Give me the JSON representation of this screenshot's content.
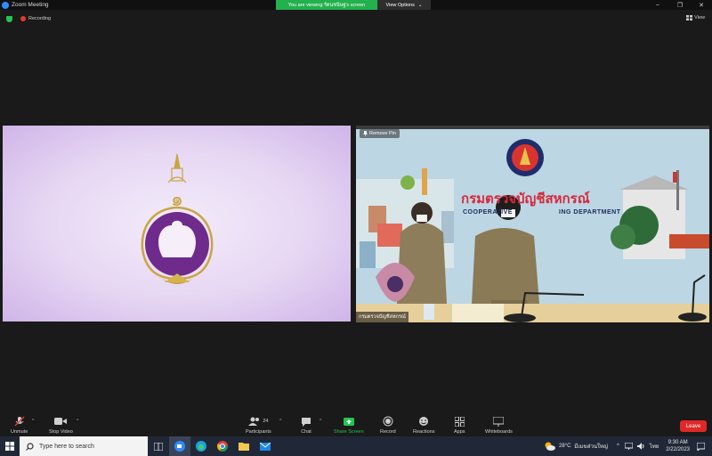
{
  "window": {
    "title": "Zoom Meeting",
    "minimize": "–",
    "restore": "❐",
    "close": "✕"
  },
  "share_banner": {
    "text": "You are viewing รัตนชนิษฐ's screen"
  },
  "view_options": {
    "label": "View Options",
    "caret": "⌄"
  },
  "recording": {
    "label": "Recording"
  },
  "view": {
    "label": "View"
  },
  "right_tile": {
    "remove_pin": "Remove Pin",
    "wall_title": "กรมตรวจบัญชีสหกรณ์",
    "wall_sub_1": "COOPERATIVE",
    "wall_sub_2": "ING  DEPARTMENT",
    "name_badge": "กรมตรวจบัญชีสหกรณ์"
  },
  "toolbar": {
    "unmute": "Unmute",
    "stop_video": "Stop Video",
    "participants": "Participants",
    "participants_count": "24",
    "chat": "Chat",
    "share_screen": "Share Screen",
    "record": "Record",
    "reactions": "Reactions",
    "apps": "Apps",
    "whiteboards": "Whiteboards",
    "leave": "Leave"
  },
  "taskbar": {
    "search_placeholder": "Type here to search",
    "weather": "28°C",
    "weather_desc": "มีเมฆส่วนใหญ่",
    "lang": "ไทย",
    "time": "9:30 AM",
    "date": "2/22/2023"
  },
  "colors": {
    "share_green": "#22b14c",
    "leave_red": "#e02828",
    "zoom_blue": "#2d8cff",
    "taskbar": "#202838"
  }
}
